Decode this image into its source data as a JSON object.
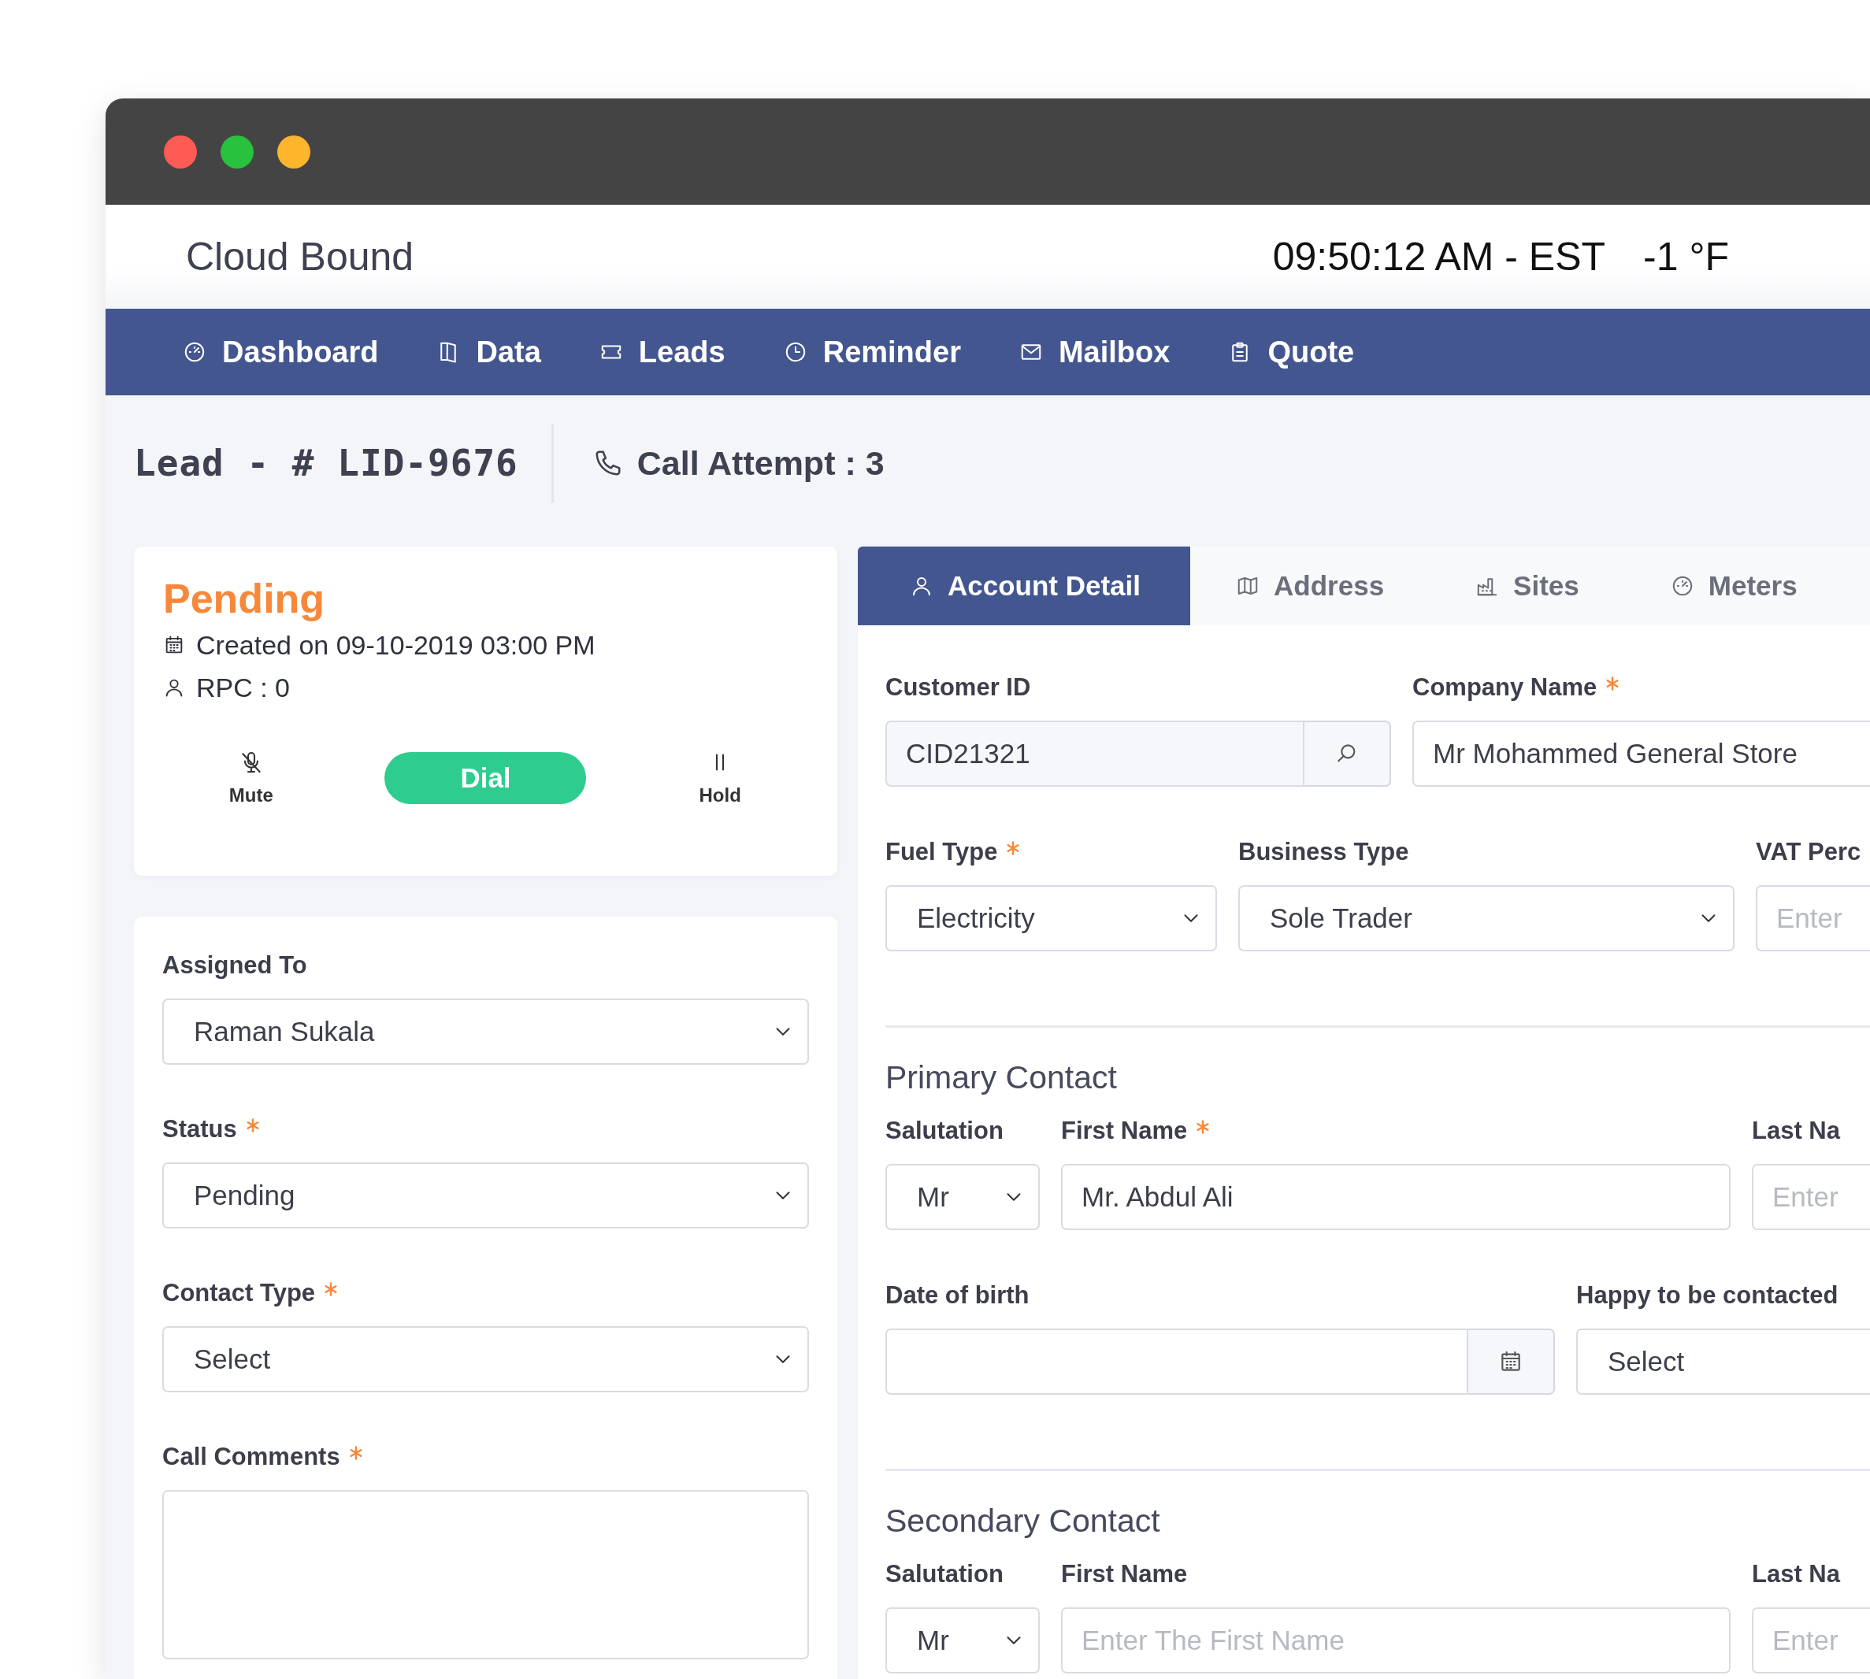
{
  "header": {
    "brand": "Cloud Bound",
    "clock": "09:50:12 AM - EST",
    "temperature": "-1 °F"
  },
  "nav": [
    "Dashboard",
    "Data",
    "Leads",
    "Reminder",
    "Mailbox",
    "Quote"
  ],
  "lead": {
    "title": "Lead - # LID-9676",
    "call_attempt": "Call Attempt : 3"
  },
  "status_card": {
    "status": "Pending",
    "created": "Created on 09-10-2019 03:00 PM",
    "rpc": "RPC : 0",
    "actions": [
      {
        "kind": "mute",
        "label": "Mute"
      },
      {
        "kind": "dial",
        "label": "Dial"
      },
      {
        "kind": "hold",
        "label": "Hold"
      }
    ]
  },
  "side_form": {
    "fields": [
      {
        "label": "Assigned To",
        "required": false,
        "kind": "select",
        "value": "Raman Sukala"
      },
      {
        "label": "Status",
        "required": true,
        "kind": "select",
        "value": "Pending"
      },
      {
        "label": "Contact Type",
        "required": true,
        "kind": "select",
        "value": "Select"
      },
      {
        "label": "Call Comments",
        "required": true,
        "kind": "textarea"
      }
    ]
  },
  "account": {
    "tabs": [
      {
        "label": "Account Detail",
        "selected": true
      },
      {
        "label": "Address",
        "selected": false
      },
      {
        "label": "Sites",
        "selected": false
      },
      {
        "label": "Meters",
        "selected": false
      }
    ],
    "sections": [
      {
        "fields": [
          {
            "label": "Customer ID",
            "required": false,
            "kind": "search",
            "value": "CID21321"
          },
          {
            "label": "Company Name",
            "required": true,
            "kind": "input",
            "value": "Mr Mohammed General Store"
          },
          {
            "label": "Fuel Type",
            "required": true,
            "kind": "select",
            "value": "Electricity"
          },
          {
            "label": "Business Type",
            "required": false,
            "kind": "select",
            "value": "Sole Trader"
          },
          {
            "label": "VAT Perc",
            "required": false,
            "kind": "input",
            "placeholder": "Enter"
          }
        ]
      },
      {
        "heading": "Primary Contact",
        "fields": [
          {
            "label": "Salutation",
            "required": false,
            "kind": "select",
            "value": "Mr"
          },
          {
            "label": "First Name",
            "required": true,
            "kind": "input",
            "value": "Mr. Abdul Ali"
          },
          {
            "label": "Last Na",
            "required": false,
            "kind": "input",
            "placeholder": "Enter"
          },
          {
            "label": "Date of birth",
            "required": false,
            "kind": "date"
          },
          {
            "label": "Happy to be contacted",
            "required": false,
            "kind": "select",
            "value": "Select"
          }
        ]
      },
      {
        "heading": "Secondary Contact",
        "fields": [
          {
            "label": "Salutation",
            "required": false,
            "kind": "select",
            "value": "Mr"
          },
          {
            "label": "First Name",
            "required": false,
            "kind": "input",
            "placeholder": "Enter The First Name"
          },
          {
            "label": "Last Na",
            "required": false,
            "kind": "input",
            "placeholder": "Enter"
          }
        ]
      }
    ]
  }
}
